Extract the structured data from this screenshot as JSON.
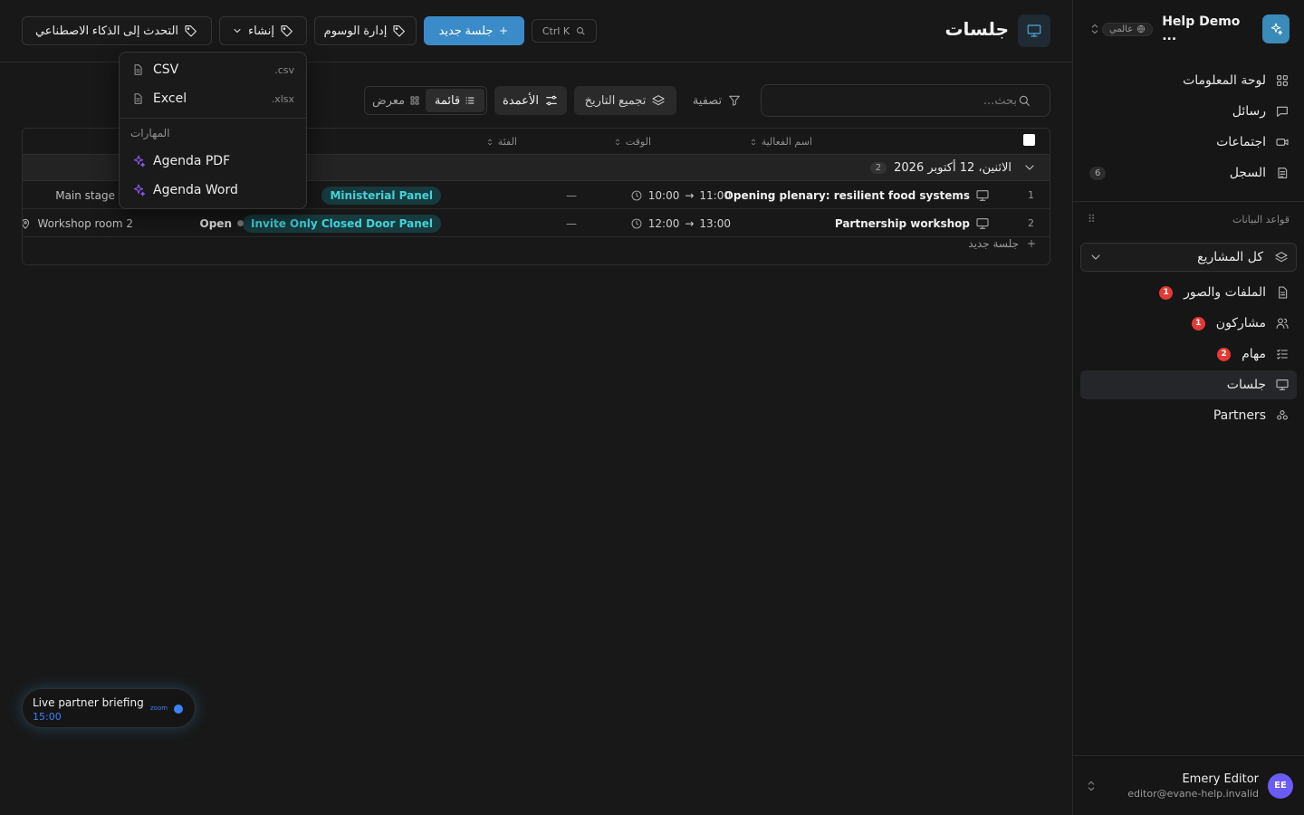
{
  "sidebar": {
    "workspace_name": "Help Demo ...",
    "workspace_scope": "عالمي",
    "nav": [
      {
        "label": "لوحة المعلومات",
        "icon": "dashboard-icon"
      },
      {
        "label": "رسائل",
        "icon": "message-icon"
      },
      {
        "label": "اجتماعات",
        "icon": "video-icon"
      },
      {
        "label": "السجل",
        "icon": "log-icon",
        "count": "6"
      }
    ],
    "databases_label": "قواعد البيانات",
    "project_selector": "كل المشاريع",
    "db_items": [
      {
        "label": "الملفات والصور",
        "icon": "file-icon",
        "badge": "1"
      },
      {
        "label": "مشاركون",
        "icon": "users-icon",
        "badge": "1"
      },
      {
        "label": "مهام",
        "icon": "tasks-icon",
        "badge": "2"
      },
      {
        "label": "جلسات",
        "icon": "presentation-icon",
        "active": true
      },
      {
        "label": "Partners",
        "icon": "partners-icon"
      }
    ],
    "user": {
      "initials": "EE",
      "name": "Emery Editor",
      "email": "editor@evane-help.invalid"
    }
  },
  "header": {
    "title": "جلسات",
    "shortcut": "Ctrl K",
    "new_session": "جلسة جديد",
    "manage_tags": "إدارة الوسوم",
    "create": "إنشاء",
    "ai_chat": "التحدث إلى الذكاء الاصطناعي"
  },
  "toolbar": {
    "search_placeholder": "بحث...",
    "filter": "تصفية",
    "group_by": "تجميع التاريخ",
    "columns": "الأعمدة",
    "view_list": "قائمة",
    "view_gallery": "معرض"
  },
  "table": {
    "columns": {
      "name": "اسم الفعالية",
      "time": "الوقت",
      "category": "الفئة"
    },
    "group": {
      "label": "الاثنين، 12 أكتوبر 2026",
      "count": "2"
    },
    "rows": [
      {
        "num": "1",
        "name": "Opening plenary: resilient food systems",
        "start": "10:00",
        "end": "11:00",
        "notes": "—",
        "tag": "Ministerial Panel",
        "status": "",
        "location": "Main stage"
      },
      {
        "num": "2",
        "name": "Partnership workshop",
        "start": "12:00",
        "end": "13:00",
        "notes": "—",
        "tag": "Invite Only Closed Door Panel",
        "status": "Open",
        "location": "Workshop room 2"
      }
    ],
    "add_row": "جلسة جديد"
  },
  "export_menu": {
    "items": [
      {
        "label": "CSV",
        "ext": ".csv"
      },
      {
        "label": "Excel",
        "ext": ".xlsx"
      }
    ],
    "skills_label": "المهارات",
    "skills": [
      {
        "label": "Agenda PDF"
      },
      {
        "label": "Agenda Word"
      }
    ]
  },
  "meeting_pill": {
    "title": "Live partner briefing",
    "time": "15:00",
    "provider": "zoom"
  },
  "colors": {
    "accent": "#3a8bc8",
    "tag_bg": "#163a3d",
    "tag_text": "#43d2d9",
    "badge_red": "#e53935",
    "skill_icon": "#8b5cf6"
  }
}
